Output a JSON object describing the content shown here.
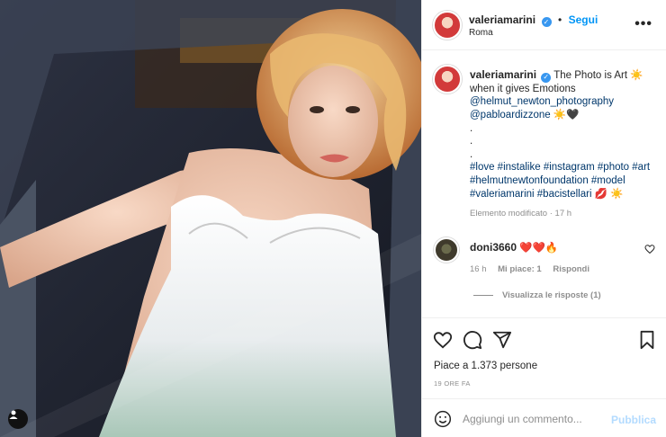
{
  "post": {
    "username": "valeriamarini",
    "follow_label": "Segui",
    "separator": "•",
    "location": "Roma",
    "more_label": "•••"
  },
  "caption": {
    "username": "valeriamarini",
    "text_line1": "The Photo is Art",
    "text_line2": "when it gives Emotions",
    "mention1": "@helmut_newton_photography",
    "mention2": "@pabloardizzone",
    "dot": ".",
    "hashtags_line1": "#love #instalike #instagram #photo #art",
    "hashtags_line2": "#helmutnewtonfoundation #model",
    "hashtags_line3": "#valeriamarini #bacistellari",
    "edited_label": "Elemento modificato",
    "edited_time": "17 h"
  },
  "comment": {
    "username": "doni3660",
    "time": "16 h",
    "likes_label": "Mi piace: 1",
    "reply_label": "Rispondi",
    "view_replies": "Visualizza le risposte (1)"
  },
  "actions": {
    "likes_text": "Piace a 1.373 persone",
    "time_ago": "19 ORE FA"
  },
  "comment_input": {
    "placeholder": "Aggiungi un commento...",
    "publish_label": "Pubblica"
  },
  "colors": {
    "link": "#00376b",
    "follow": "#0095f6",
    "verified": "#3897f0",
    "publish_disabled": "#b3dbff",
    "heart_red": "#ed4956"
  },
  "icons": [
    "verified-badge-icon",
    "more-options-icon",
    "heart-icon",
    "comment-icon",
    "share-icon",
    "bookmark-icon",
    "emoji-icon",
    "user-tag-icon",
    "sun-emoji",
    "black-heart-emoji",
    "kiss-emoji",
    "red-heart-emoji",
    "fire-emoji"
  ]
}
